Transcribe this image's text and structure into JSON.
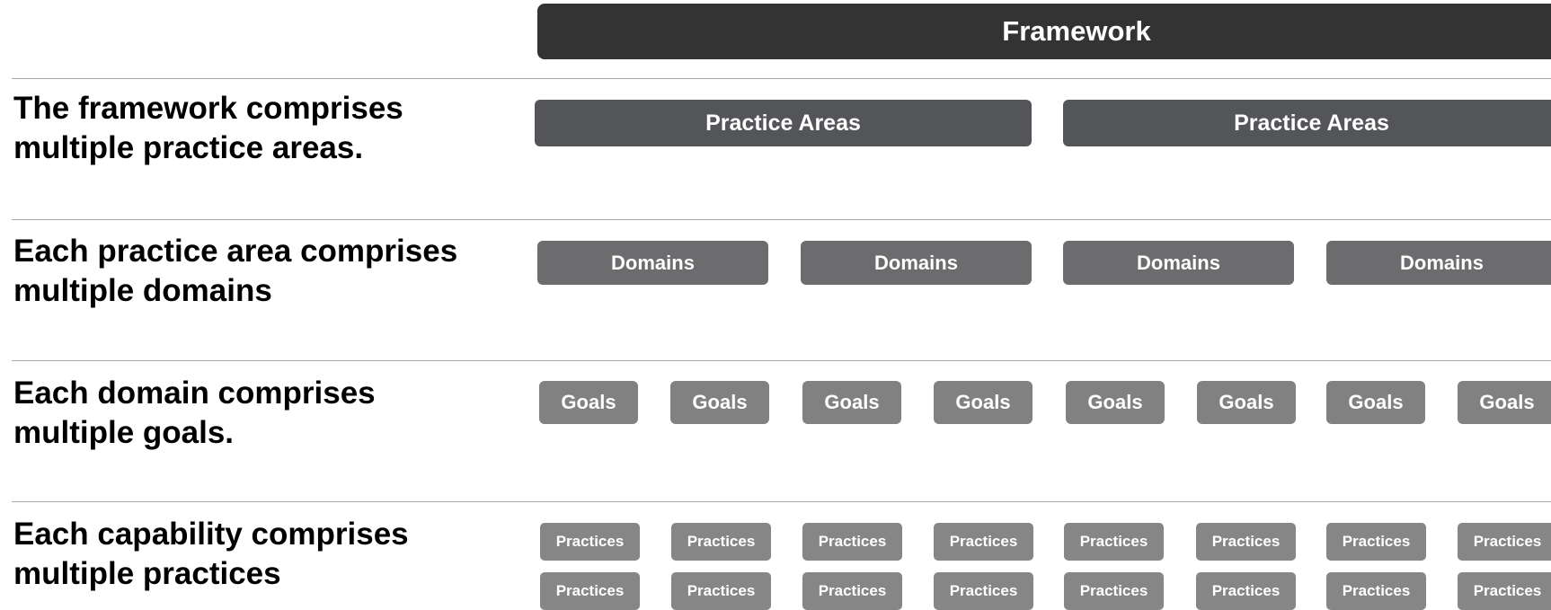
{
  "framework": {
    "label": "Framework"
  },
  "rows": [
    {
      "label": "The framework comprises multiple practice areas."
    },
    {
      "label": "Each practice area comprises multiple domains"
    },
    {
      "label": "Each domain comprises multiple goals."
    },
    {
      "label": "Each capability comprises multiple practices"
    }
  ],
  "practice_areas": [
    "Practice Areas",
    "Practice Areas"
  ],
  "domains": [
    "Domains",
    "Domains",
    "Domains",
    "Domains"
  ],
  "goals": [
    "Goals",
    "Goals",
    "Goals",
    "Goals",
    "Goals",
    "Goals",
    "Goals",
    "Goals"
  ],
  "practices": [
    [
      "Practices",
      "Practices",
      "Practices",
      "Practices",
      "Practices",
      "Practices",
      "Practices",
      "Practices"
    ],
    [
      "Practices",
      "Practices",
      "Practices",
      "Practices",
      "Practices",
      "Practices",
      "Practices",
      "Practices"
    ]
  ],
  "colors": {
    "framework": "#333333",
    "practice_area": "#545558",
    "domain": "#6c6c6e",
    "goal": "#818182",
    "practice": "#868687",
    "divider": "#a6a6a6"
  }
}
